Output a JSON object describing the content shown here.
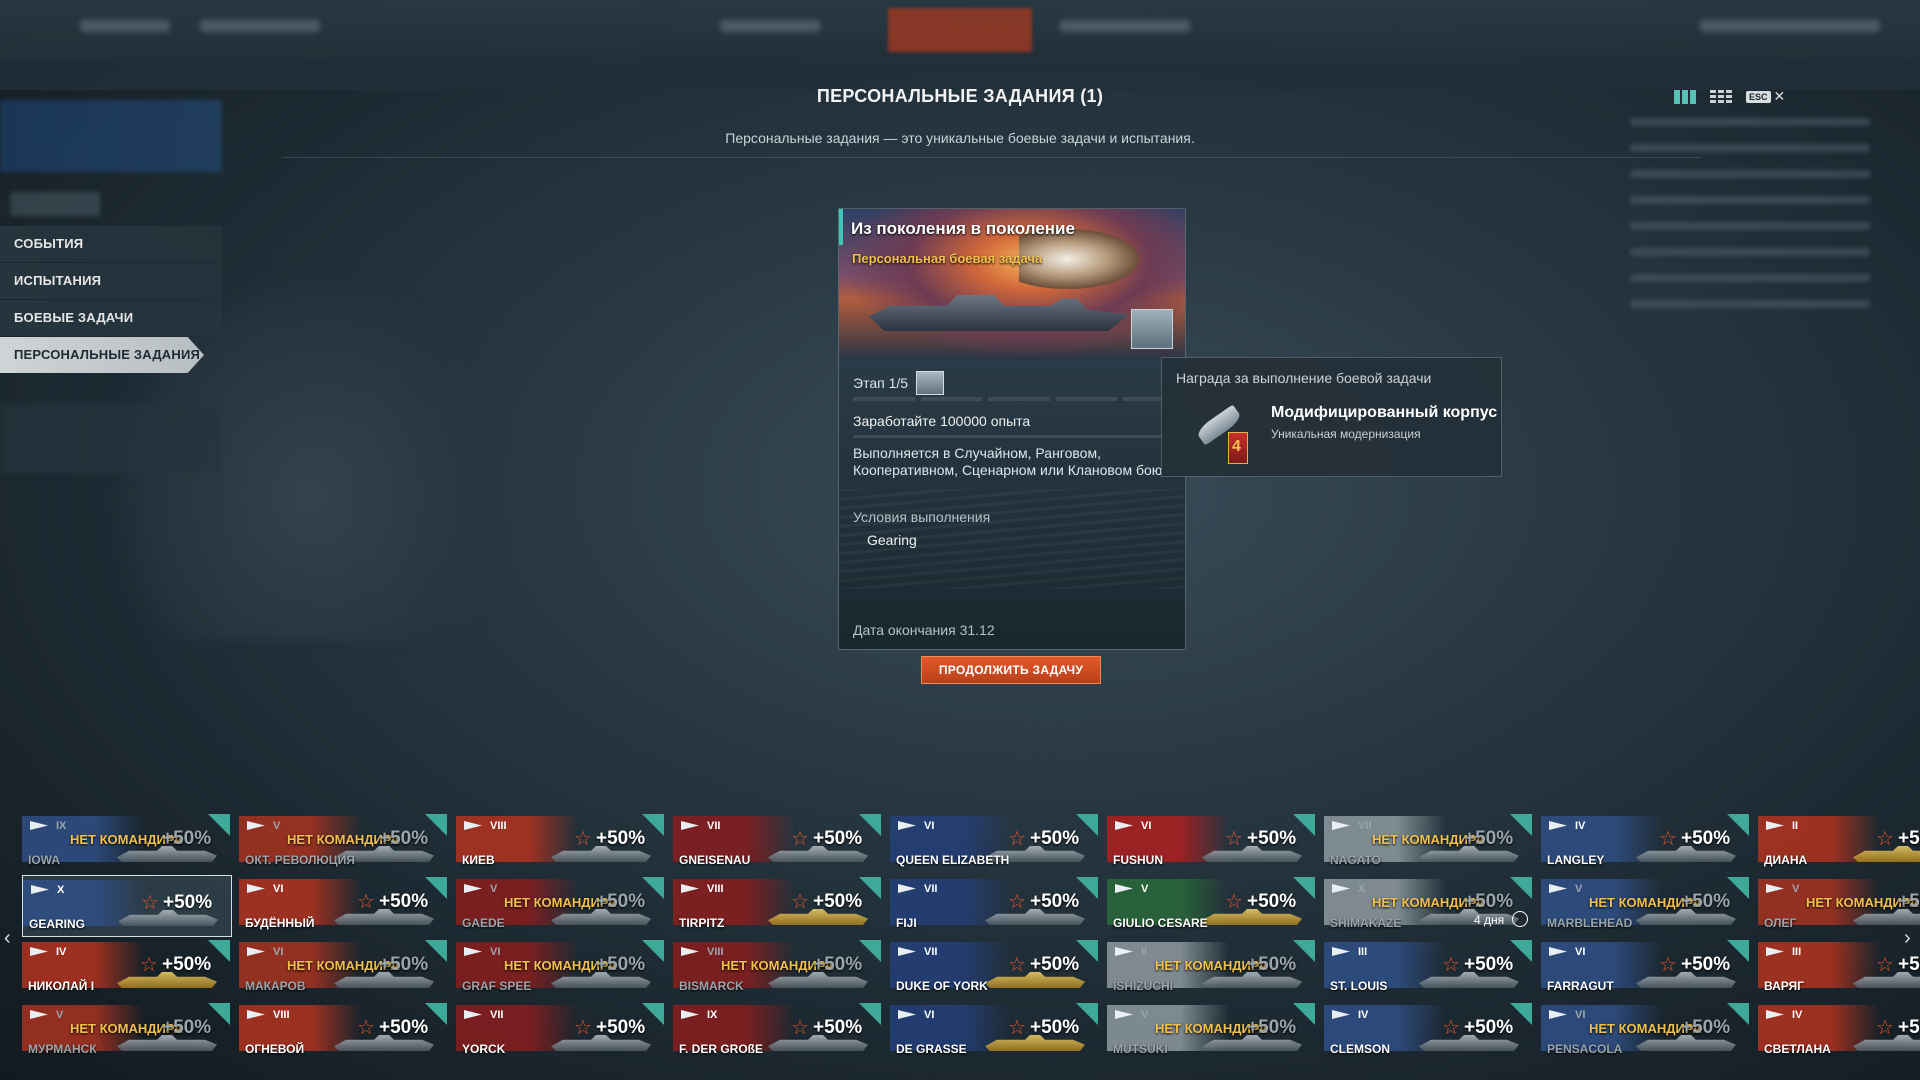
{
  "header": {
    "title": "ПЕРСОНАЛЬНЫЕ ЗАДАНИЯ (1)",
    "subtitle": "Персональные задания — это уникальные боевые задачи и испытания.",
    "esc_label": "ESC",
    "close_glyph": "✕"
  },
  "left_menu": {
    "items": [
      {
        "label": "СОБЫТИЯ"
      },
      {
        "label": "ИСПЫТАНИЯ"
      },
      {
        "label": "БОЕВЫЕ ЗАДАЧИ"
      },
      {
        "label": "ПЕРСОНАЛЬНЫЕ ЗАДАНИЯ"
      }
    ],
    "active_index": 3
  },
  "mission_card": {
    "title": "Из поколения в поколение",
    "type": "Персональная боевая задача",
    "stage": "Этап 1/5",
    "goal": "Заработайте 100000 опыта",
    "description": "Выполняется в Случайном, Ранговом, Кооперативном, Сценарном или Клановом бою",
    "conditions_label": "Условия выполнения",
    "conditions_value": "Gearing",
    "end_date": "Дата окончания 31.12",
    "continue_button": "ПРОДОЛЖИТЬ ЗАДАЧУ"
  },
  "reward_tooltip": {
    "heading": "Награда за выполнение боевой задачи",
    "name": "Модифицированный корпус",
    "subtitle": "Уникальная модернизация",
    "badge_number": "4"
  },
  "port": {
    "no_commander": "НЕТ КОМАНДИРА",
    "bonus": "+50%",
    "ships": [
      {
        "name": "IOWA",
        "tier": "IX",
        "no_commander": true,
        "flag": "#2f4f86"
      },
      {
        "name": "ОКТ. РЕВОЛЮЦИЯ",
        "tier": "V",
        "no_commander": true,
        "flag": "#a8321f"
      },
      {
        "name": "КИЕВ",
        "tier": "VIII",
        "no_commander": false,
        "flag": "#b3321f"
      },
      {
        "name": "GNEISENAU",
        "tier": "VII",
        "no_commander": false,
        "flag": "#8a1d1d"
      },
      {
        "name": "QUEEN ELIZABETH",
        "tier": "VI",
        "no_commander": false,
        "flag": "#243f7a"
      },
      {
        "name": "FUSHUN",
        "tier": "VI",
        "no_commander": false,
        "flag": "#b01e1e"
      },
      {
        "name": "NAGATO",
        "tier": "VII",
        "no_commander": true,
        "flag": "#8e9aa0"
      },
      {
        "name": "LANGLEY",
        "tier": "IV",
        "no_commander": false,
        "flag": "#2f4f86"
      },
      {
        "name": "ДИАНА",
        "tier": "II",
        "no_commander": false,
        "flag": "#b3321f",
        "gold": true
      },
      {
        "name": "GEARING",
        "tier": "X",
        "no_commander": false,
        "flag": "#2f4f86",
        "selected": true
      },
      {
        "name": "БУДЁННЫЙ",
        "tier": "VI",
        "no_commander": false,
        "flag": "#b3321f"
      },
      {
        "name": "GAEDE",
        "tier": "V",
        "no_commander": true,
        "flag": "#8a1d1d"
      },
      {
        "name": "TIRPITZ",
        "tier": "VIII",
        "no_commander": false,
        "flag": "#8a1d1d",
        "gold": true
      },
      {
        "name": "FIJI",
        "tier": "VII",
        "no_commander": false,
        "flag": "#243f7a"
      },
      {
        "name": "GIULIO CESARE",
        "tier": "V",
        "no_commander": false,
        "flag": "#2a6b3a",
        "gold": true
      },
      {
        "name": "SHIMAKAZE",
        "tier": "X",
        "no_commander": true,
        "flag": "#8e9aa0",
        "timer": "4 дня"
      },
      {
        "name": "MARBLEHEAD",
        "tier": "V",
        "no_commander": true,
        "flag": "#2f4f86"
      },
      {
        "name": "ОЛЕГ",
        "tier": "V",
        "no_commander": true,
        "flag": "#a8321f"
      },
      {
        "name": "НИКОЛАЙ I",
        "tier": "IV",
        "no_commander": false,
        "flag": "#b3321f",
        "gold": true
      },
      {
        "name": "МАКАРОВ",
        "tier": "VI",
        "no_commander": true,
        "flag": "#a8321f"
      },
      {
        "name": "GRAF SPEE",
        "tier": "VI",
        "no_commander": true,
        "flag": "#8a1d1d"
      },
      {
        "name": "BISMARCK",
        "tier": "VIII",
        "no_commander": true,
        "flag": "#8a1d1d"
      },
      {
        "name": "DUKE OF YORK",
        "tier": "VII",
        "no_commander": false,
        "flag": "#243f7a",
        "gold": true
      },
      {
        "name": "ISHIZUCHI",
        "tier": "II",
        "no_commander": true,
        "flag": "#8e9aa0"
      },
      {
        "name": "ST. LOUIS",
        "tier": "III",
        "no_commander": false,
        "flag": "#2f4f86"
      },
      {
        "name": "FARRAGUT",
        "tier": "VI",
        "no_commander": false,
        "flag": "#2f4f86"
      },
      {
        "name": "ВАРЯГ",
        "tier": "III",
        "no_commander": false,
        "flag": "#b3321f"
      },
      {
        "name": "МУРМАНСК",
        "tier": "V",
        "no_commander": true,
        "flag": "#a8321f"
      },
      {
        "name": "ОГНЕВОЙ",
        "tier": "VIII",
        "no_commander": false,
        "flag": "#b3321f"
      },
      {
        "name": "YORCK",
        "tier": "VII",
        "no_commander": false,
        "flag": "#8a1d1d"
      },
      {
        "name": "F. DER GROßE",
        "tier": "IX",
        "no_commander": false,
        "flag": "#8a1d1d"
      },
      {
        "name": "DE GRASSE",
        "tier": "VI",
        "no_commander": false,
        "flag": "#243f7a",
        "gold": true
      },
      {
        "name": "MUTSUKI",
        "tier": "V",
        "no_commander": true,
        "flag": "#8e9aa0"
      },
      {
        "name": "CLEMSON",
        "tier": "IV",
        "no_commander": false,
        "flag": "#2f4f86"
      },
      {
        "name": "PENSACOLA",
        "tier": "VI",
        "no_commander": true,
        "flag": "#2f4f86"
      },
      {
        "name": "СВЕТЛАНА",
        "tier": "IV",
        "no_commander": false,
        "flag": "#b3321f"
      }
    ]
  },
  "colors": {
    "accent_teal": "#3fc4b7",
    "mission_type_gold": "#f2c04c",
    "button_orange": "#e25a2a"
  }
}
